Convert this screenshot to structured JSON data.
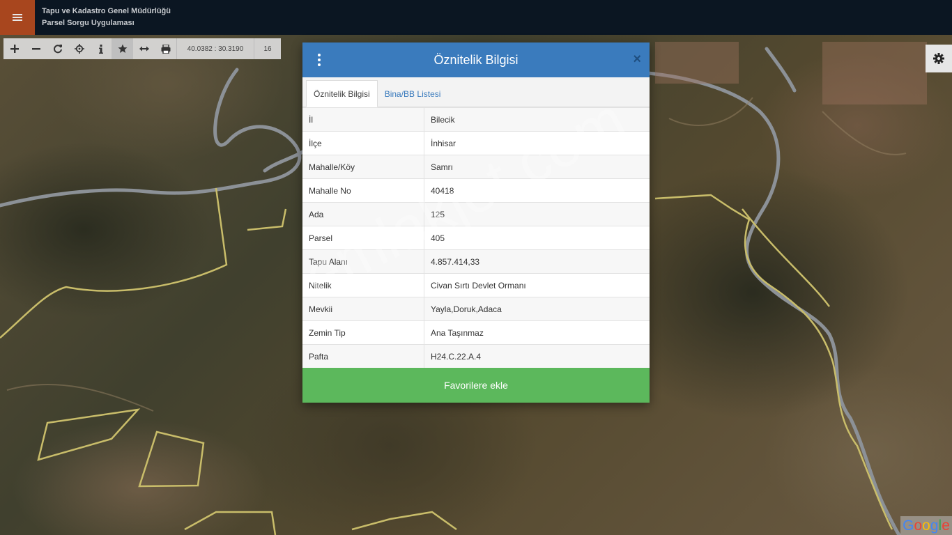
{
  "header": {
    "title_line1": "Tapu ve Kadastro Genel Müdürlüğü",
    "title_line2": "Parsel Sorgu Uygulaması"
  },
  "toolbar": {
    "tools": [
      "zoom-in-icon",
      "zoom-out-icon",
      "refresh-icon",
      "locate-icon",
      "info-icon",
      "star-icon",
      "measure-icon",
      "print-icon"
    ],
    "coordinates": "40.0382 : 30.3190",
    "zoom_level": "16"
  },
  "modal": {
    "title": "Öznitelik Bilgisi",
    "close_symbol": "×",
    "tabs": [
      {
        "label": "Öznitelik Bilgisi",
        "active": true
      },
      {
        "label": "Bina/BB Listesi",
        "active": false
      }
    ],
    "rows": [
      {
        "key": "İl",
        "value": "Bilecik"
      },
      {
        "key": "İlçe",
        "value": "İnhisar"
      },
      {
        "key": "Mahalle/Köy",
        "value": "Samrı"
      },
      {
        "key": "Mahalle No",
        "value": "40418"
      },
      {
        "key": "Ada",
        "value": "125"
      },
      {
        "key": "Parsel",
        "value": "405"
      },
      {
        "key": "Tapu Alanı",
        "value": "4.857.414,33"
      },
      {
        "key": "Nitelik",
        "value": "Civan Sırtı Devlet Ormanı"
      },
      {
        "key": "Mevkii",
        "value": "Yayla,Doruk,Adaca"
      },
      {
        "key": "Zemin Tip",
        "value": "Ana Taşınmaz"
      },
      {
        "key": "Pafta",
        "value": "H24.C.22.A.4"
      }
    ],
    "favorite_button": "Favorilere ekle"
  },
  "map": {
    "attribution": "Google"
  },
  "watermark": "emlakjet.com",
  "colors": {
    "header_bg": "#0b1622",
    "menu_button": "#a8461e",
    "modal_header": "#3a7bbd",
    "favorite_button": "#5cb85c",
    "parcel_outline": "#c9bd6a",
    "road": "#8a8f96"
  }
}
